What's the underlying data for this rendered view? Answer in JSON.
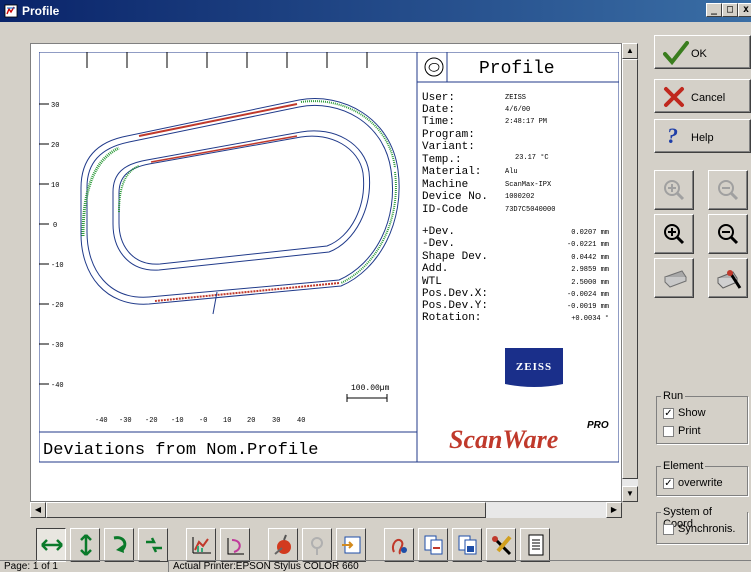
{
  "window": {
    "title": "Profile",
    "min": "_",
    "max": "□",
    "close": "x"
  },
  "report": {
    "title": "Profile",
    "footer_caption": "Deviations from Nom.Profile",
    "scale_label": "100.00µm",
    "y_ticks": [
      "30",
      "20",
      "10",
      "0",
      "-10",
      "-20",
      "-30",
      "-40"
    ],
    "x_ticks": [
      "-40",
      "-30",
      "-20",
      "-10",
      "-0",
      "10",
      "20",
      "30",
      "40"
    ],
    "info": [
      {
        "label": "User:",
        "value": "ZEISS"
      },
      {
        "label": "Date:",
        "value": "4/6/00"
      },
      {
        "label": "Time:",
        "value": "2:48:17 PM"
      },
      {
        "label": "Program:",
        "value": ""
      },
      {
        "label": "Variant:",
        "value": ""
      },
      {
        "label": "Temp.:",
        "value": "23.17 °C"
      },
      {
        "label": "Material:",
        "value": "Alu"
      },
      {
        "label": "Machine",
        "value": "ScanMax-IPX"
      },
      {
        "label": "Device No.",
        "value": "1000202"
      },
      {
        "label": "ID-Code",
        "value": "73D7C5040000"
      }
    ],
    "results": [
      {
        "label": "+Dev.",
        "value": "0.0207 mm"
      },
      {
        "label": "-Dev.",
        "value": "-0.0221 mm"
      },
      {
        "label": "Shape Dev.",
        "value": "0.0442 mm"
      },
      {
        "label": "Add.",
        "value": "2.9859 mm"
      },
      {
        "label": "WTL",
        "value": "2.5000 mm"
      },
      {
        "label": "Pos.Dev.X:",
        "value": "-0.0024 mm"
      },
      {
        "label": "Pos.Dev.Y:",
        "value": "-0.0019 mm"
      },
      {
        "label": "Rotation:",
        "value": "+0.0034 °"
      }
    ],
    "zeiss_logo": "ZEISS",
    "brand": "ScanWare",
    "brand_suffix": "PRO"
  },
  "side": {
    "ok": "OK",
    "cancel": "Cancel",
    "help": "Help"
  },
  "groups": {
    "run": {
      "title": "Run",
      "show": "Show",
      "show_checked": "✓",
      "print": "Print",
      "print_checked": ""
    },
    "element": {
      "title": "Element",
      "overwrite": "overwrite",
      "overwrite_checked": "✓"
    },
    "coord": {
      "title": "System of Coord.",
      "synchronis": "Synchronis.",
      "synchronis_checked": ""
    }
  },
  "status": {
    "page": "Page: 1 of 1",
    "printer": "Actual Printer:EPSON Stylus COLOR 660"
  }
}
